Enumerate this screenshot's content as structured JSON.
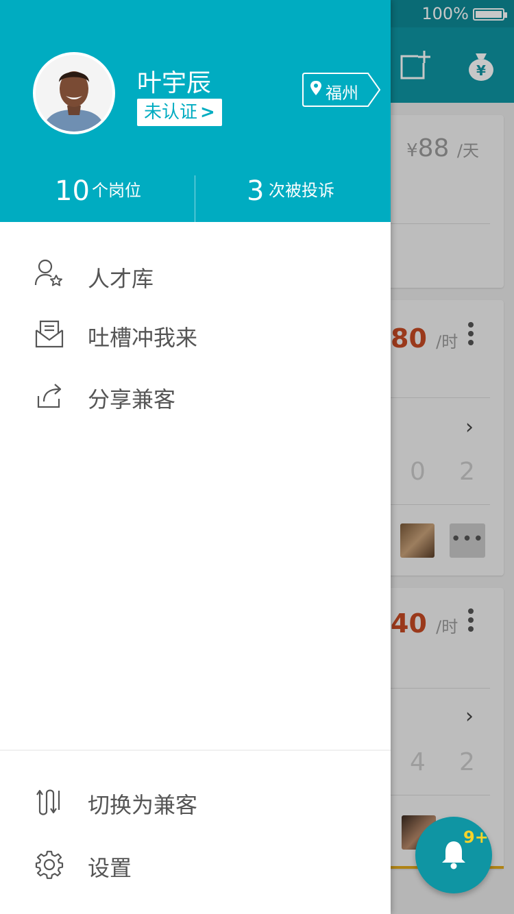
{
  "status_bar": {
    "battery_percent": "100%"
  },
  "app_bar": {
    "icons": [
      "add-post-icon",
      "money-bag-icon"
    ]
  },
  "background_cards": [
    {
      "rate_currency": "¥",
      "rate_value": "88",
      "rate_unit": "/天"
    },
    {
      "rate_value": "80",
      "rate_unit": "/时",
      "stats": [
        "0",
        "2"
      ]
    },
    {
      "rate_value": "40",
      "rate_unit": "/时",
      "stats": [
        "4",
        "2"
      ]
    }
  ],
  "notification": {
    "badge": "9+"
  },
  "drawer": {
    "user": {
      "name": "叶宇辰",
      "verify_label": "未认证",
      "location": "福州"
    },
    "stats": {
      "jobs_count": "10",
      "jobs_label": "个岗位",
      "complaints_count": "3",
      "complaints_label": "次被投诉"
    },
    "menu": [
      {
        "label": "人才库",
        "icon": "talent-pool-icon"
      },
      {
        "label": "吐槽冲我来",
        "icon": "mail-icon"
      },
      {
        "label": "分享兼客",
        "icon": "share-icon"
      }
    ],
    "bottom_menu": [
      {
        "label": "切换为兼客",
        "icon": "switch-icon"
      },
      {
        "label": "设置",
        "icon": "gear-icon"
      }
    ]
  },
  "colors": {
    "accent": "#00acc1",
    "app_bar": "#0f95a3",
    "rate_red": "#c64a23",
    "badge_yellow": "#f5d32a"
  }
}
